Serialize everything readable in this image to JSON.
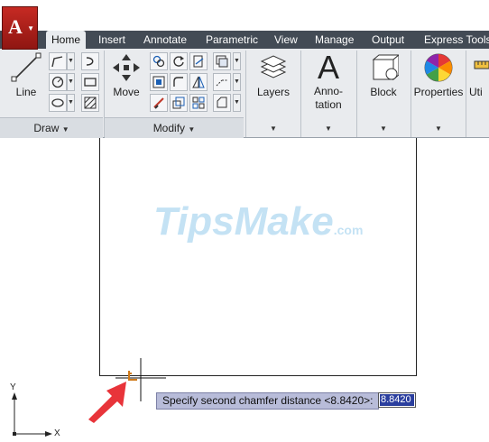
{
  "app": {
    "logo_letter": "A"
  },
  "tabs": [
    {
      "label": "Home",
      "active": true
    },
    {
      "label": "Insert",
      "active": false
    },
    {
      "label": "Annotate",
      "active": false
    },
    {
      "label": "Parametric",
      "active": false
    },
    {
      "label": "View",
      "active": false
    },
    {
      "label": "Manage",
      "active": false
    },
    {
      "label": "Output",
      "active": false
    },
    {
      "label": "Express Tools",
      "active": false
    }
  ],
  "ribbon": {
    "draw": {
      "line_label": "Line",
      "footer": "Draw"
    },
    "modify": {
      "move_label": "Move",
      "footer": "Modify"
    },
    "layers_label": "Layers",
    "annotation_label_1": "Anno-",
    "annotation_label_2": "tation",
    "block_label": "Block",
    "properties_label": "Properties",
    "utilities_label": "Uti"
  },
  "canvas": {
    "watermark_main": "TipsMake",
    "watermark_suffix": ".com",
    "ucs_y": "Y",
    "ucs_x": "X"
  },
  "command": {
    "prompt": "Specify second chamfer distance <8.8420>:",
    "input_value": "8.8420"
  },
  "colors": {
    "tabbar": "#434b55",
    "app_red": "#c62a23",
    "command_bg": "#b8bcd9",
    "selection": "#2b3f9e",
    "arrow": "#e8343a"
  }
}
